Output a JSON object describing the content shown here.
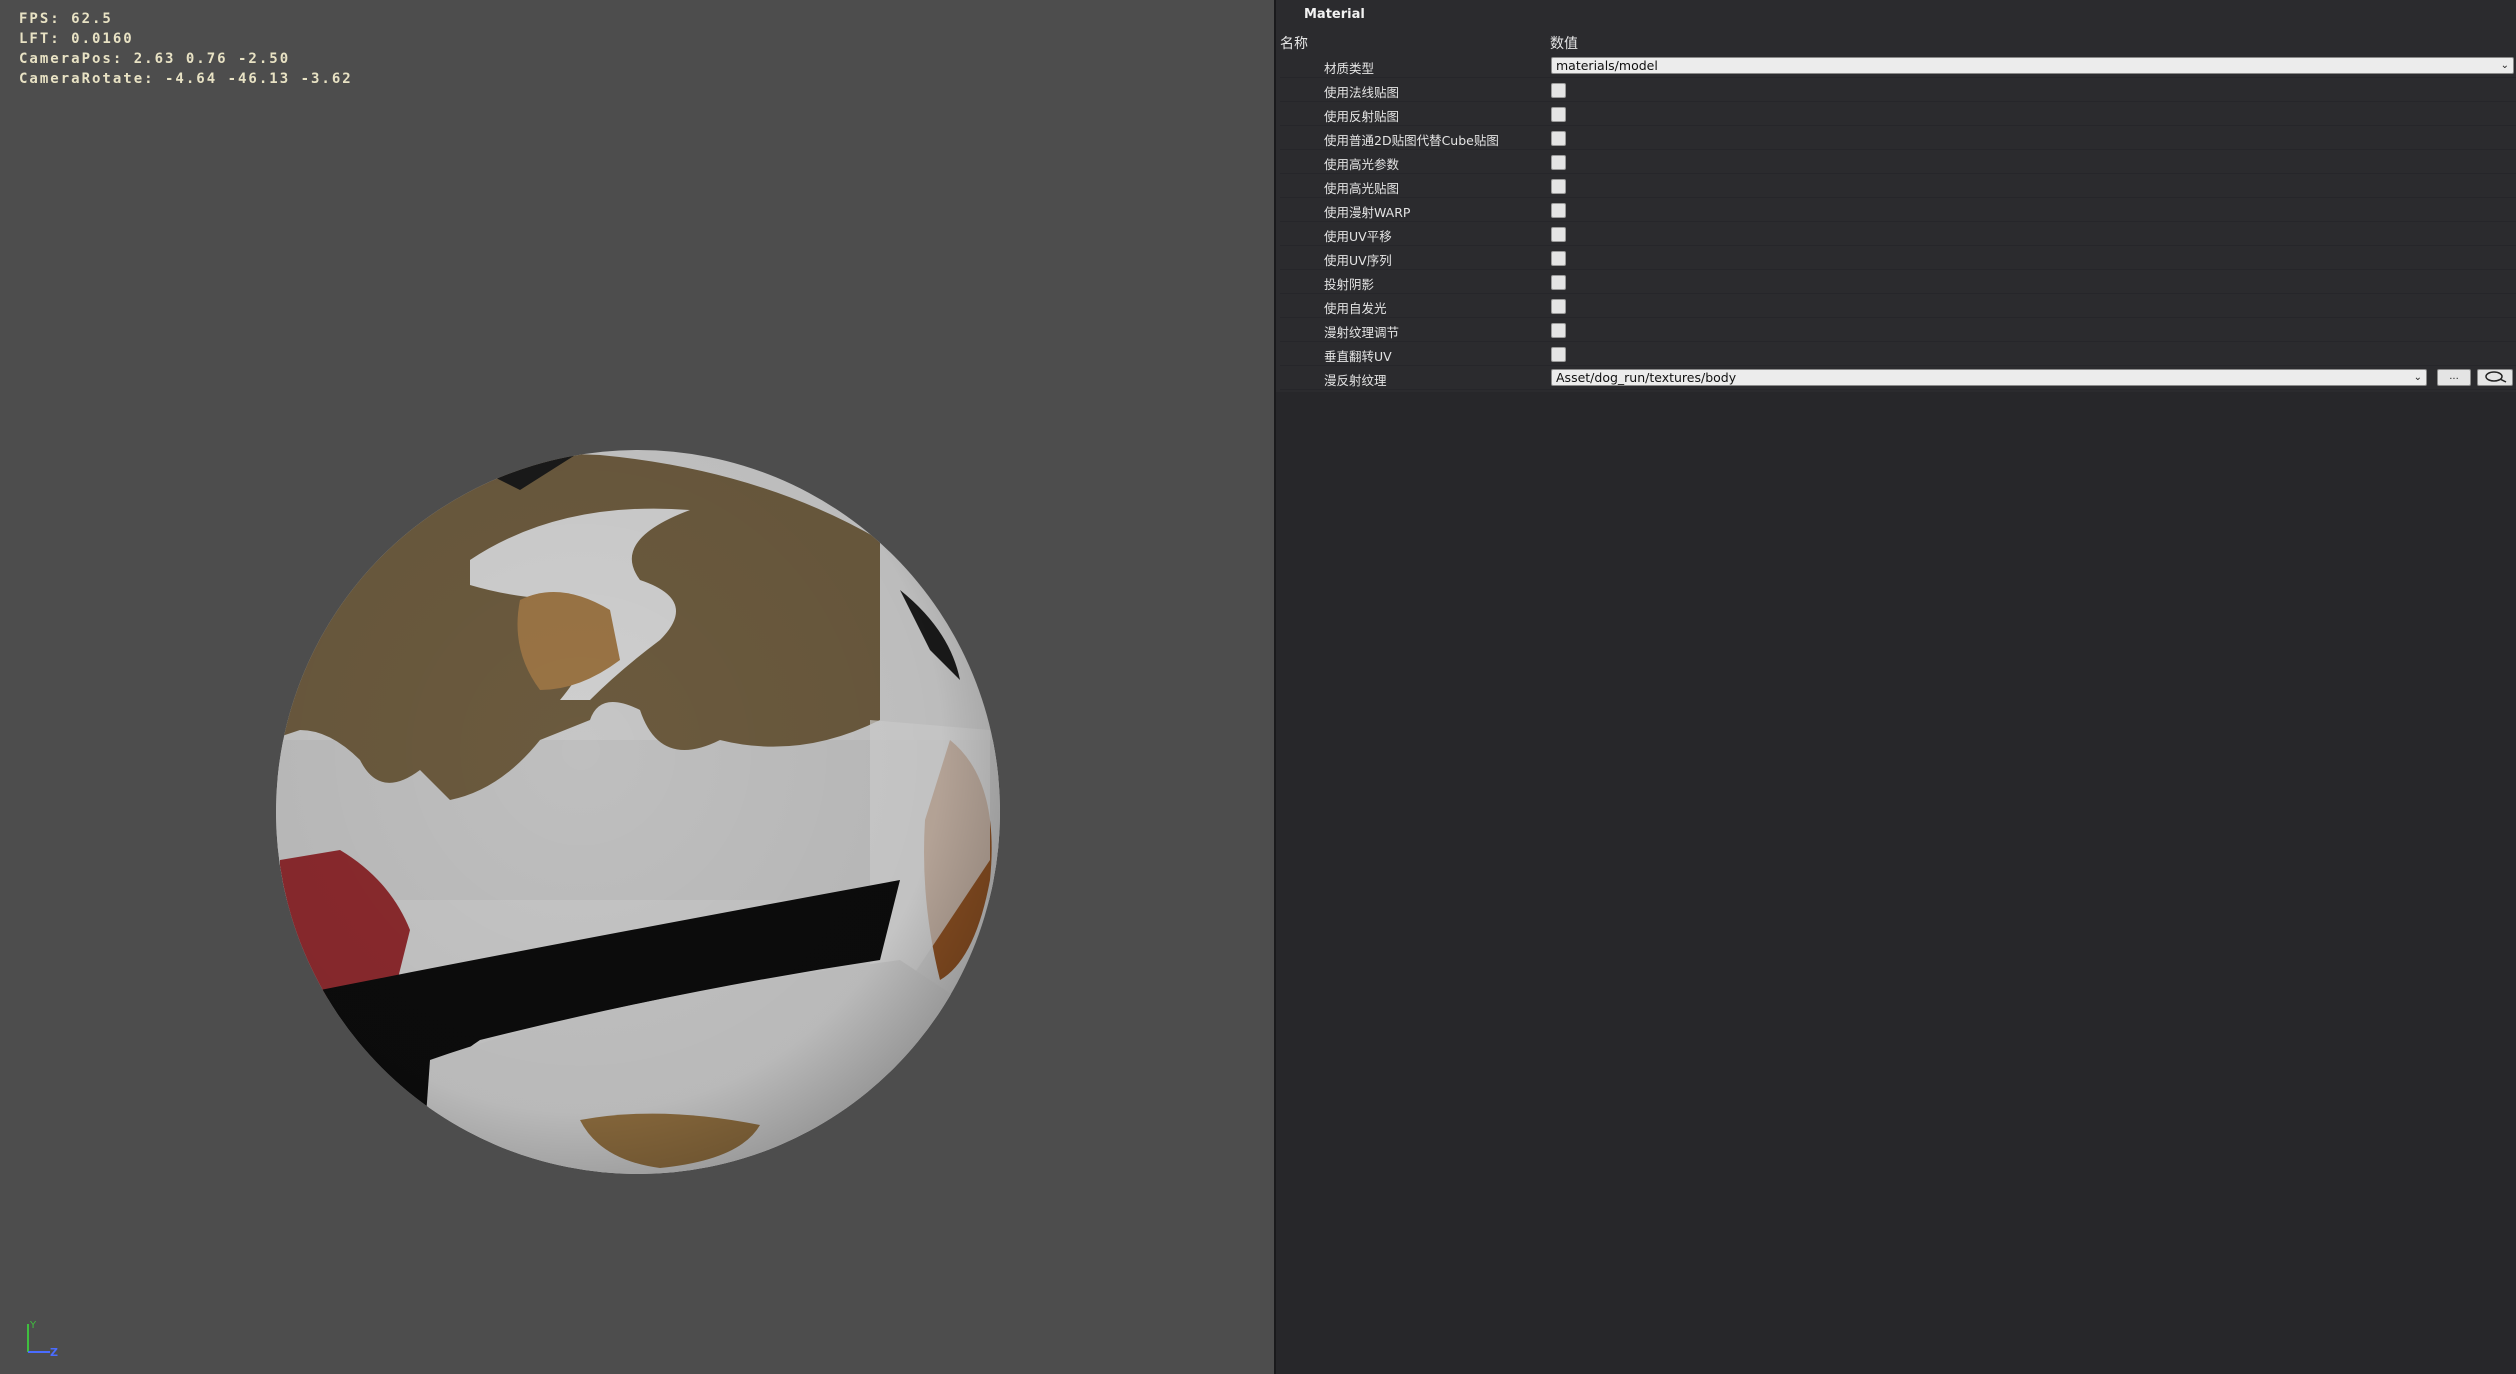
{
  "viewport": {
    "stats": {
      "fps": "FPS: 62.5",
      "lft": "LFT: 0.0160",
      "camera_pos": "CameraPos: 2.63 0.76 -2.50",
      "camera_rotate": "CameraRotate: -4.64 -46.13 -3.62"
    },
    "axis": {
      "y_label": "Y",
      "z_label": "Z"
    }
  },
  "panel": {
    "title": "Material",
    "columns": {
      "name": "名称",
      "value": "数值"
    },
    "material_type": {
      "label": "材质类型",
      "value": "materials/model"
    },
    "checkbox_rows": [
      {
        "label": "使用法线贴图"
      },
      {
        "label": "使用反射贴图"
      },
      {
        "label": "使用普通2D贴图代替Cube贴图"
      },
      {
        "label": "使用高光参数"
      },
      {
        "label": "使用高光贴图"
      },
      {
        "label": "使用漫射WARP"
      },
      {
        "label": "使用UV平移"
      },
      {
        "label": "使用UV序列"
      },
      {
        "label": "投射阴影"
      },
      {
        "label": "使用自发光"
      },
      {
        "label": "漫射纹理调节"
      },
      {
        "label": "垂直翻转UV"
      }
    ],
    "diffuse_texture": {
      "label": "漫反射纹理",
      "value": "Asset/dog_run/textures/body",
      "browse_label": "..."
    }
  },
  "colors": {
    "viewport_bg": "#4d4d4d",
    "panel_bg": "#2b2b2e",
    "stats_text": "#e8e2c4",
    "axis_y": "#3fbf3f",
    "axis_z": "#4a6cff"
  }
}
